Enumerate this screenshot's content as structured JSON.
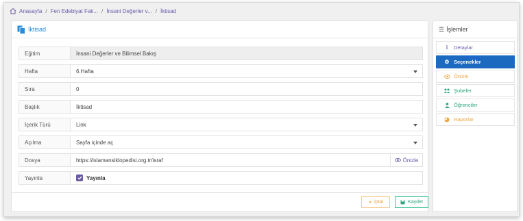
{
  "breadcrumb": {
    "items": [
      "Anasayfa",
      "Fen Edebiyat Fak...",
      "İnsani Değerler v...",
      "İktisad"
    ],
    "separator": "/"
  },
  "card": {
    "title": "İktisad"
  },
  "form": {
    "egitim": {
      "label": "Eğitim",
      "value": "İnsani Değerler ve Bilimsel Bakış"
    },
    "hafta": {
      "label": "Hafta",
      "value": "6.Hafta"
    },
    "sira": {
      "label": "Sıra",
      "value": "0"
    },
    "baslik": {
      "label": "Başlık",
      "value": "İktisad"
    },
    "icerik_turu": {
      "label": "İçerik Türü",
      "value": "Link"
    },
    "acilma": {
      "label": "Açılma",
      "value": "Sayfa içinde aç"
    },
    "dosya": {
      "label": "Dosya",
      "value": "https://islamansiklopedisi.org.tr/israf",
      "preview_label": "Önizle"
    },
    "yayinla": {
      "label": "Yayınla",
      "checkbox_label": "Yayınla",
      "checked": true
    }
  },
  "actions": {
    "cancel_label": "İptal",
    "save_label": "Kaydet"
  },
  "sidebar": {
    "title": "İşlemler",
    "items": [
      {
        "label": "Detaylar",
        "icon": "info-icon",
        "color": "#6b5aa8"
      },
      {
        "label": "Seçenekler",
        "icon": "gear-icon",
        "color": "#ffffff",
        "active": true
      },
      {
        "label": "Önizle",
        "icon": "eye-icon",
        "color": "#f0a640"
      },
      {
        "label": "Şubeler",
        "icon": "users-icon",
        "color": "#2aa67d"
      },
      {
        "label": "Öğrenciler",
        "icon": "user-icon",
        "color": "#2aa67d"
      },
      {
        "label": "Raporlar",
        "icon": "pie-chart-icon",
        "color": "#f0a640"
      }
    ]
  },
  "colors": {
    "accent": "#6b5aa8",
    "primary": "#1b6ac0",
    "title_blue": "#2a8bd9",
    "warning": "#f0a640",
    "success": "#2aa67d"
  }
}
